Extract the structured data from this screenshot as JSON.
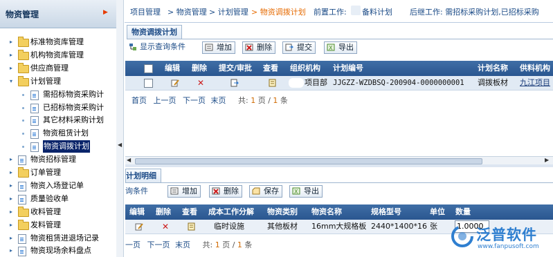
{
  "sidebar": {
    "title": "物资管理",
    "items": [
      {
        "label": "标准物资库管理",
        "type": "folder",
        "indent": 0
      },
      {
        "label": "机构物资库管理",
        "type": "folder",
        "indent": 0
      },
      {
        "label": "供应商管理",
        "type": "folder",
        "indent": 0
      },
      {
        "label": "计划管理",
        "type": "folder",
        "indent": 0,
        "expanded": true
      },
      {
        "label": "需招标物资采购计",
        "type": "doc",
        "indent": 1
      },
      {
        "label": "已招标物资采购计",
        "type": "doc",
        "indent": 1
      },
      {
        "label": "其它材料采购计划",
        "type": "doc",
        "indent": 1
      },
      {
        "label": "物资租赁计划",
        "type": "doc",
        "indent": 1
      },
      {
        "label": "物资调拨计划",
        "type": "doc",
        "indent": 1,
        "selected": true
      },
      {
        "label": "物资招标管理",
        "type": "doc",
        "indent": 0
      },
      {
        "label": "订单管理",
        "type": "folder",
        "indent": 0
      },
      {
        "label": "物资入场登记单",
        "type": "doc",
        "indent": 0
      },
      {
        "label": "质量验收单",
        "type": "doc",
        "indent": 0
      },
      {
        "label": "收料管理",
        "type": "folder",
        "indent": 0
      },
      {
        "label": "发料管理",
        "type": "folder",
        "indent": 0
      },
      {
        "label": "物资租赁进退场记录",
        "type": "doc",
        "indent": 0
      },
      {
        "label": "物资现场余料盘点",
        "type": "doc",
        "indent": 0
      }
    ]
  },
  "breadcrumb": {
    "items": [
      "项目管理",
      "> 物资管理",
      "> 计划管理",
      "> 物资调拨计划"
    ],
    "prev_work": "前置工作:",
    "prev_work_value": "备料计划",
    "next_work": "后继工作: 需招标采购计划,已招标采购"
  },
  "upper": {
    "tab": "物资调拨计划",
    "show_query": "显示查询条件",
    "buttons": {
      "add": "增加",
      "delete": "删除",
      "submit": "提交",
      "export": "导出"
    },
    "columns": [
      "编辑",
      "删除",
      "提交/审批",
      "查看",
      "组织机构",
      "计划编号",
      "计划名称",
      "供料机构"
    ],
    "rows": [
      {
        "org": "项目部",
        "plan_no": "JJGZZ-WZDBSQ-200904-0000000001",
        "plan_name": "调拨板材",
        "supplier": "九江项目"
      }
    ],
    "pager": {
      "first": "首页",
      "prev": "上一页",
      "next": "下一页",
      "last": "末页",
      "total_label": "共:",
      "page": "1",
      "page_sep": "页 /",
      "total_pages": "1",
      "count_label": "条"
    }
  },
  "lower": {
    "tab": "计划明细",
    "query": "询条件",
    "buttons": {
      "add": "增加",
      "delete": "删除",
      "save": "保存",
      "export": "导出"
    },
    "columns": [
      "编辑",
      "删除",
      "查看",
      "成本工作分解",
      "物资类别",
      "物资名称",
      "规格型号",
      "单位",
      "数量"
    ],
    "rows": [
      {
        "cost": "临时设施",
        "category": "其他板材",
        "name": "16mm大规格板",
        "spec": "2440*1400*16",
        "unit": "张",
        "qty": "1.0000"
      }
    ],
    "pager": {
      "first": "一页",
      "prev": "下一页",
      "last": "末页",
      "total_label": "共:",
      "page": "1",
      "page_sep": "页 /",
      "total_pages": "1",
      "count_label": "条"
    }
  },
  "logo": {
    "name": "泛普软件",
    "url": "www.fanpusoft.com"
  },
  "colors": {
    "header_blue": "#2a5690",
    "accent_orange": "#e66a00",
    "row_bg": "#e1eaf4"
  }
}
